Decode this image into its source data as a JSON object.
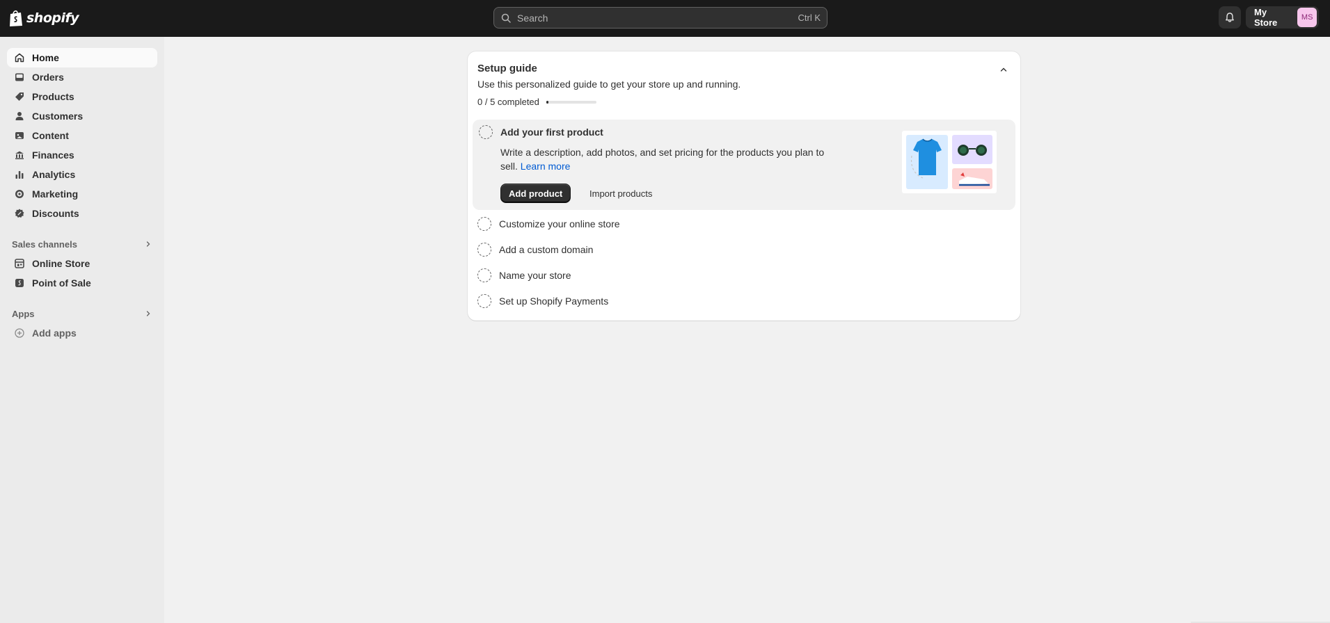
{
  "topbar": {
    "brand": "shopify",
    "search_placeholder": "Search",
    "search_shortcut": "Ctrl K",
    "store_name": "My Store",
    "avatar_initials": "MS"
  },
  "sidebar": {
    "main_items": [
      {
        "label": "Home",
        "icon": "home-icon",
        "active": true
      },
      {
        "label": "Orders",
        "icon": "inbox-icon"
      },
      {
        "label": "Products",
        "icon": "tag-icon"
      },
      {
        "label": "Customers",
        "icon": "person-icon"
      },
      {
        "label": "Content",
        "icon": "image-icon"
      },
      {
        "label": "Finances",
        "icon": "bank-icon"
      },
      {
        "label": "Analytics",
        "icon": "bar-chart-icon"
      },
      {
        "label": "Marketing",
        "icon": "target-icon"
      },
      {
        "label": "Discounts",
        "icon": "discount-icon"
      }
    ],
    "sales_channels_label": "Sales channels",
    "sales_channels": [
      {
        "label": "Online Store",
        "icon": "store-icon"
      },
      {
        "label": "Point of Sale",
        "icon": "pos-icon"
      }
    ],
    "apps_label": "Apps",
    "add_apps_label": "Add apps"
  },
  "setup_guide": {
    "title": "Setup guide",
    "subtitle": "Use this personalized guide to get your store up and running.",
    "progress_text": "0 / 5 completed",
    "progress_fraction": 0.05,
    "active_task": {
      "title": "Add your first product",
      "description": "Write a description, add photos, and set pricing for the products you plan to sell.",
      "learn_more": "Learn more",
      "primary_button": "Add product",
      "secondary_button": "Import products"
    },
    "tasks": [
      "Customize your online store",
      "Add a custom domain",
      "Name your store",
      "Set up Shopify Payments"
    ]
  },
  "colors": {
    "topbar_bg": "#1a1a1a",
    "page_bg": "#f1f1f1",
    "sidebar_bg": "#ebebeb",
    "link": "#005bd3",
    "primary_button": "#303030",
    "avatar_bg": "#f7c6ec"
  }
}
